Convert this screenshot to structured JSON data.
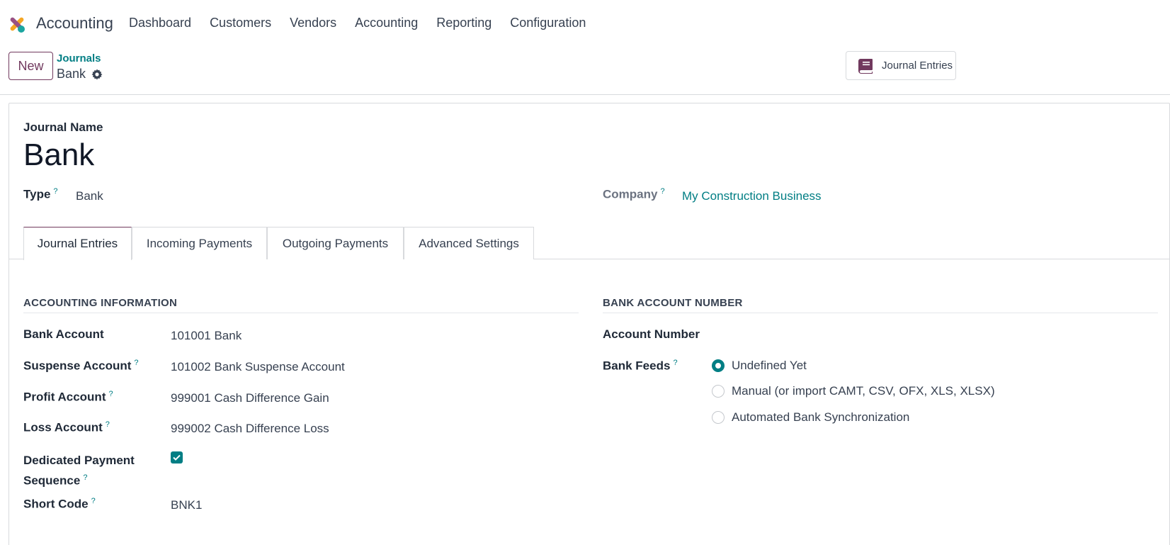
{
  "navbar": {
    "app_name": "Accounting",
    "menu": [
      "Dashboard",
      "Customers",
      "Vendors",
      "Accounting",
      "Reporting",
      "Configuration"
    ]
  },
  "control_panel": {
    "new_label": "New",
    "breadcrumb_parent": "Journals",
    "breadcrumb_current": "Bank",
    "smart_button_label": "Journal Entries"
  },
  "form": {
    "journal_name_label": "Journal Name",
    "journal_name": "Bank",
    "type_label": "Type",
    "type_value": "Bank",
    "company_label": "Company",
    "company_value": "My Construction Business",
    "help_mark": "?",
    "tabs": [
      "Journal Entries",
      "Incoming Payments",
      "Outgoing Payments",
      "Advanced Settings"
    ],
    "active_tab": "Journal Entries",
    "accounting_section": {
      "title": "ACCOUNTING INFORMATION",
      "bank_account_label": "Bank Account",
      "bank_account_value": "101001 Bank",
      "suspense_label": "Suspense Account",
      "suspense_value": "101002 Bank Suspense Account",
      "profit_label": "Profit Account",
      "profit_value": "999001 Cash Difference Gain",
      "loss_label": "Loss Account",
      "loss_value": "999002 Cash Difference Loss",
      "dedicated_label_1": "Dedicated Payment",
      "dedicated_label_2": "Sequence",
      "dedicated_checked": true,
      "short_code_label": "Short Code",
      "short_code_value": "BNK1"
    },
    "bank_section": {
      "title": "BANK ACCOUNT NUMBER",
      "account_number_label": "Account Number",
      "bank_feeds_label": "Bank Feeds",
      "feed_options": [
        "Undefined Yet",
        "Manual (or import CAMT, CSV, OFX, XLS, XLSX)",
        "Automated Bank Synchronization"
      ],
      "selected_feed": "Undefined Yet"
    }
  },
  "colors": {
    "brand": "#71395e",
    "teal": "#017e84"
  }
}
